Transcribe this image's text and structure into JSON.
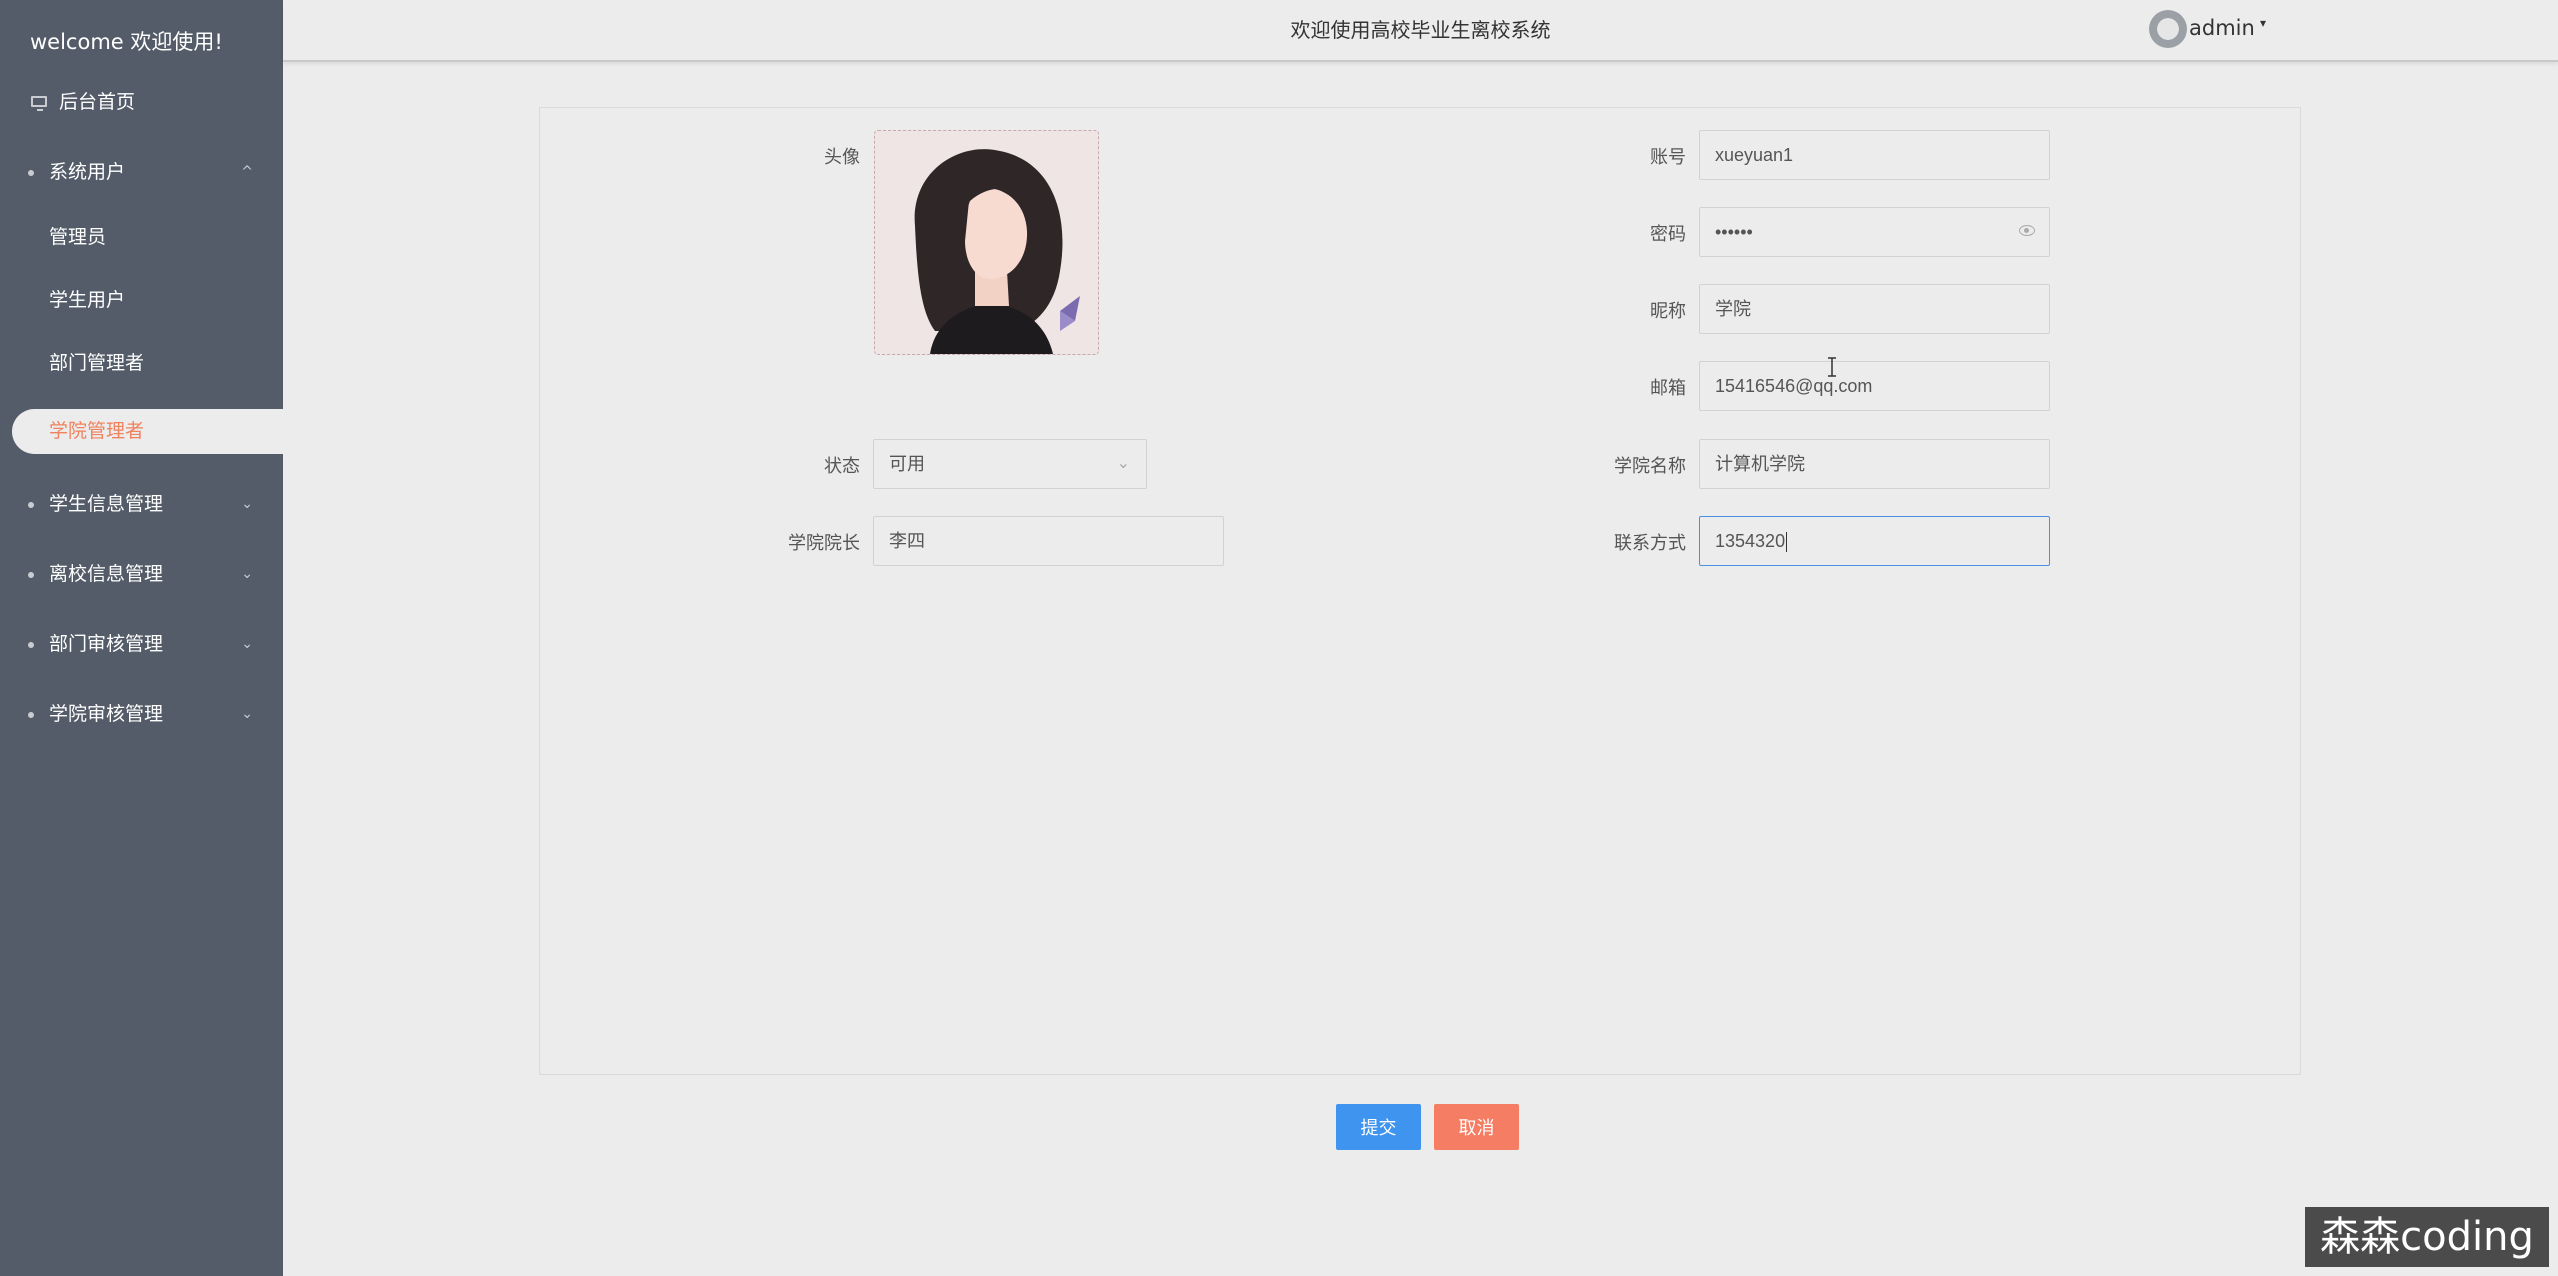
{
  "sidebar": {
    "welcome": "welcome 欢迎使用!",
    "home": "后台首页",
    "groups": [
      {
        "label": "系统用户",
        "expanded": true,
        "chevron": "^"
      },
      {
        "label": "学生信息管理",
        "chevron": "⌄"
      },
      {
        "label": "离校信息管理",
        "chevron": "⌄"
      },
      {
        "label": "部门审核管理",
        "chevron": "⌄"
      },
      {
        "label": "学院审核管理",
        "chevron": "⌄"
      }
    ],
    "sub_items": [
      "管理员",
      "学生用户",
      "部门管理者",
      "学院管理者"
    ],
    "active": "学院管理者",
    "colors": {
      "bg": "#535c68",
      "active": "#f0825e"
    }
  },
  "header": {
    "title": "欢迎使用高校毕业生离校系统",
    "user": "admin"
  },
  "form": {
    "avatar_label": "头像",
    "account_label": "账号",
    "account_value": "xueyuan1",
    "password_label": "密码",
    "password_value": "••••••",
    "nickname_label": "昵称",
    "nickname_value": "学院",
    "email_label": "邮箱",
    "email_value": "15416546@qq.com",
    "status_label": "状态",
    "status_value": "可用",
    "college_label": "学院名称",
    "college_value": "计算机学院",
    "dean_label": "学院院长",
    "dean_value": "李四",
    "contact_label": "联系方式",
    "contact_value": "1354320"
  },
  "buttons": {
    "submit": "提交",
    "cancel": "取消"
  },
  "watermark": "森森coding",
  "icons": [
    "monitor-icon",
    "chevron-up-icon",
    "chevron-down-icon",
    "eye-icon",
    "avatar-spinner-icon",
    "text-cursor-icon"
  ]
}
